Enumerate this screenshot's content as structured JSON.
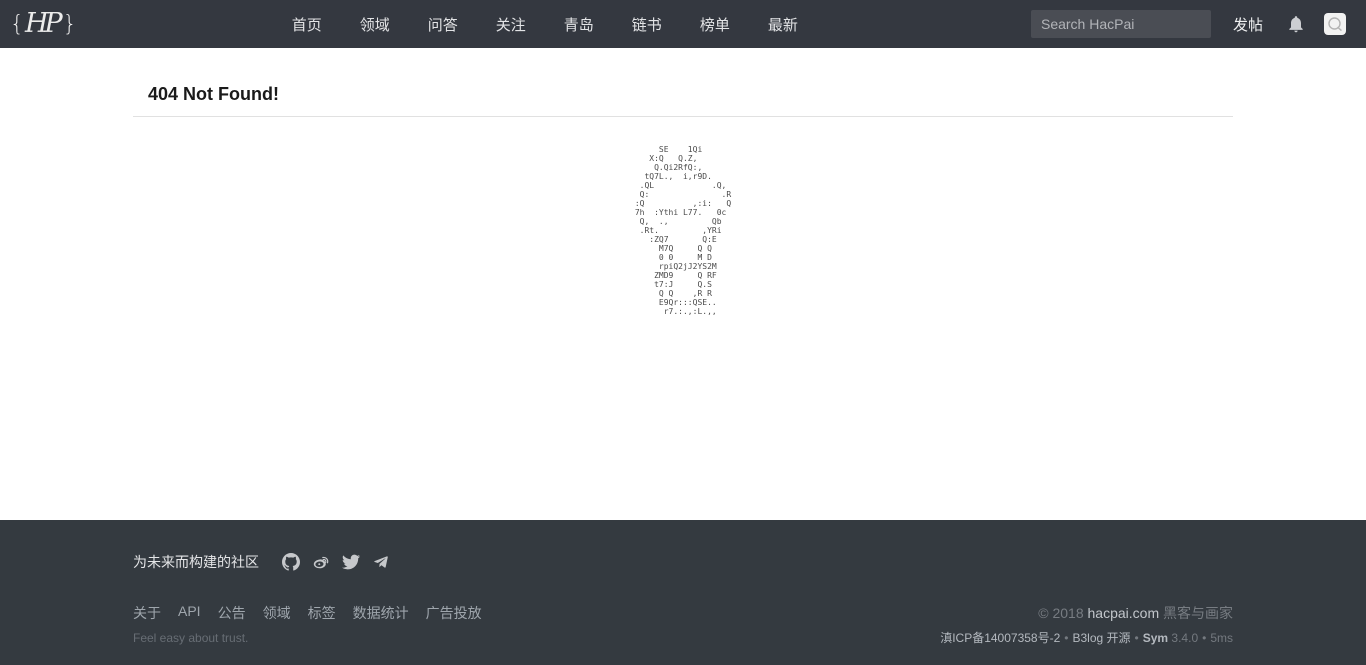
{
  "header": {
    "logo": {
      "left_brace": "{",
      "letters": "HP",
      "right_brace": "}"
    },
    "nav": {
      "items": [
        {
          "label": "首页"
        },
        {
          "label": "领域"
        },
        {
          "label": "问答"
        },
        {
          "label": "关注"
        },
        {
          "label": "青岛"
        },
        {
          "label": "链书"
        },
        {
          "label": "榜单"
        },
        {
          "label": "最新"
        }
      ]
    },
    "search": {
      "placeholder": "Search HacPai",
      "value": ""
    },
    "post_label": "发帖"
  },
  "main": {
    "title": "404 Not Found!",
    "ascii_art": {
      "lines": [
        "     SE    1Qi",
        "   X:Q   Q.Z,",
        "    Q.Qi2RfQ:,",
        "  tQ7L.,  i,r9D.",
        " .QL            .Q,",
        " Q:               .R",
        ":Q          ,:i:   Q",
        "7h  :Ythi L77.   0c",
        " Q,  .,         Qb",
        " .Rt.         ,YRi",
        "   :ZQ7       Q:E",
        "     M7Q     Q Q",
        "     0 0     M D",
        "     rpiQ2jJ2YS2M",
        "    ZMD9     Q RF",
        "    t7:J     Q.S",
        "     Q Q    ,R R",
        "     E9Qr:::QSE..",
        "      r7.:.,:L.,,"
      ]
    }
  },
  "footer": {
    "tagline": "为未来而构建的社区",
    "social_icons": [
      "github",
      "weibo",
      "twitter",
      "telegram"
    ],
    "links": [
      {
        "label": "关于"
      },
      {
        "label": "API"
      },
      {
        "label": "公告"
      },
      {
        "label": "领域"
      },
      {
        "label": "标签"
      },
      {
        "label": "数据统计"
      },
      {
        "label": "广告投放"
      }
    ],
    "slogan": "Feel easy about trust.",
    "copyright": {
      "prefix": "© 2018 ",
      "site": "hacpai.com",
      "suffix": " 黑客与画家"
    },
    "meta": {
      "icp": "滇ICP备14007358号-2",
      "sep": "•",
      "b3log": "B3log 开源",
      "sym": "Sym",
      "version": "3.4.0",
      "latency": "5ms"
    }
  },
  "colors": {
    "header_bg": "#343840",
    "footer_bg": "#343a40",
    "search_bg": "#4a4d54",
    "nav_text": "#e3e4e6",
    "footer_link": "#9fa6ad",
    "dim_text": "#777c82",
    "bright_text": "#c2c6cb",
    "art_text": "#4a4a4a"
  }
}
